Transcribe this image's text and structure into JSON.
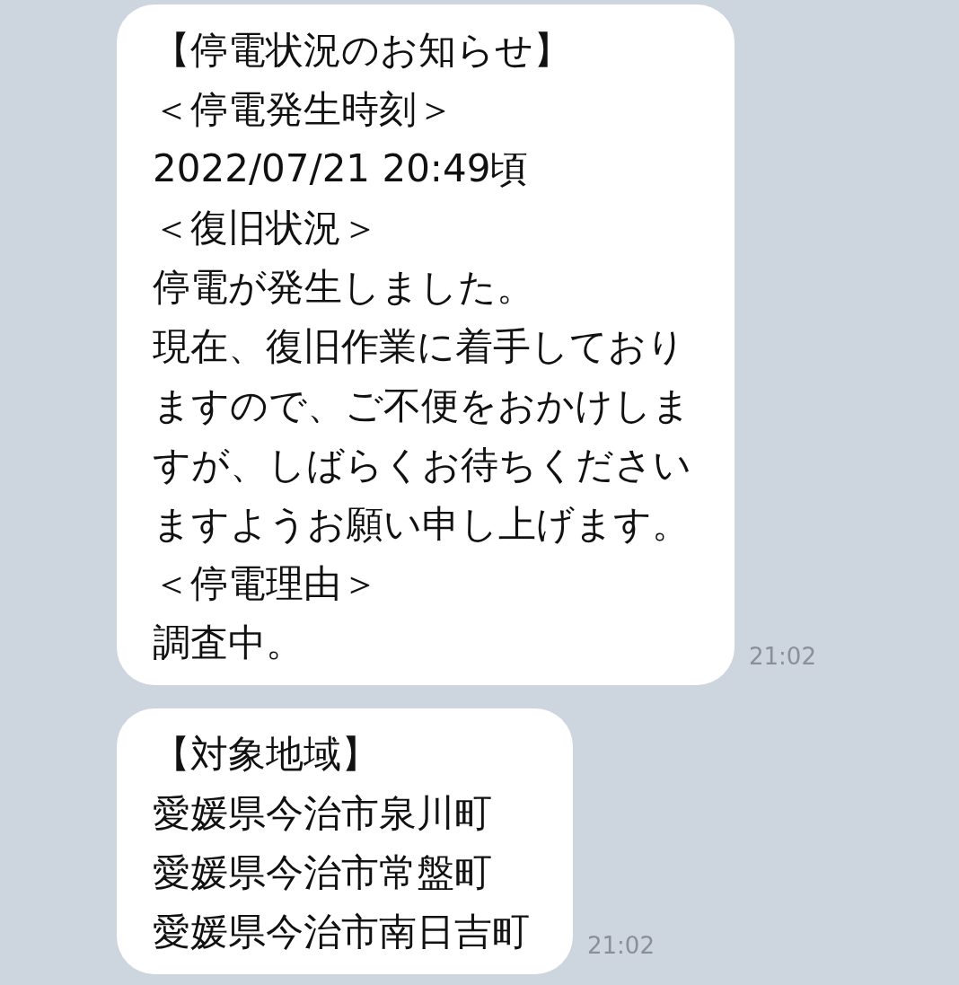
{
  "messages": [
    {
      "lines": [
        "【停電状況のお知らせ】",
        "＜停電発生時刻＞",
        "2022/07/21 20:49頃",
        "＜復旧状況＞",
        "停電が発生しました。",
        "現在、復旧作業に着手しており",
        "ますので、ご不便をおかけしま",
        "すが、しばらくお待ちください",
        "ますようお願い申し上げます。",
        "＜停電理由＞",
        "調査中。"
      ],
      "time": "21:02"
    },
    {
      "lines": [
        "【対象地域】",
        "愛媛県今治市泉川町",
        "愛媛県今治市常盤町",
        "愛媛県今治市南日吉町"
      ],
      "time": "21:02"
    }
  ]
}
